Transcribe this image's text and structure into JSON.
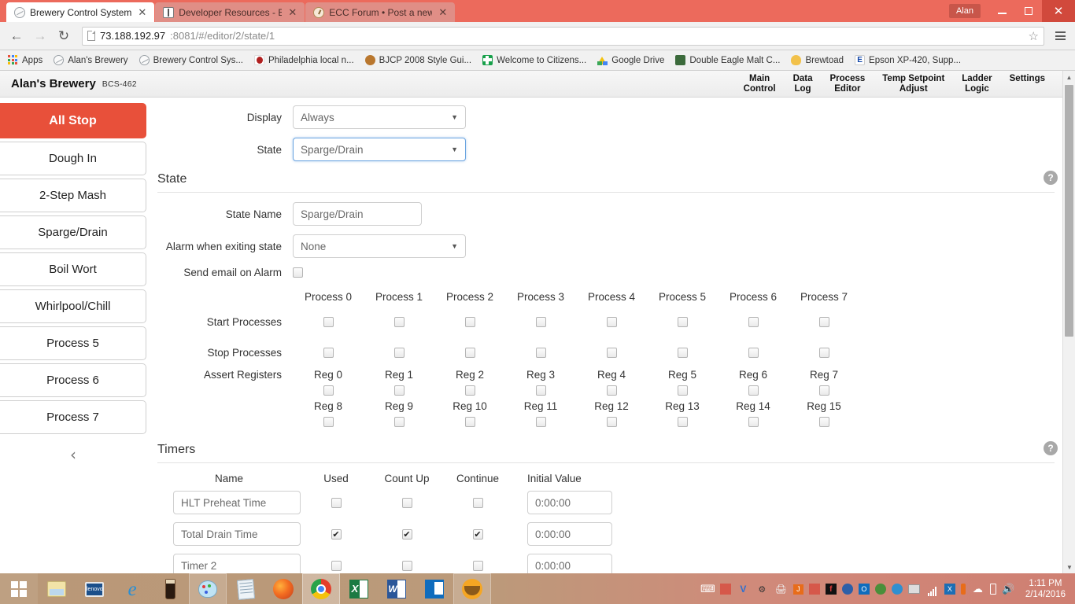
{
  "browser": {
    "tabs": [
      {
        "label": "Brewery Control System",
        "icon": "bcs-dial-icon",
        "active": true
      },
      {
        "label": "Developer Resources - BC",
        "icon": "book-icon",
        "active": false
      },
      {
        "label": "ECC Forum • Post a new to",
        "icon": "clock-icon",
        "active": false
      }
    ],
    "profile": "Alan",
    "window_controls": {
      "minimize": "–",
      "maximize": "□",
      "close": "✕"
    },
    "nav": {
      "back": "←",
      "forward": "→",
      "reload": "↻"
    },
    "url": {
      "host": "73.188.192.97",
      "rest": ":8081/#/editor/2/state/1",
      "full": "73.188.192.97:8081/#/editor/2/state/1"
    },
    "star_icon": "☆",
    "bookmarks": [
      {
        "label": "Apps",
        "icon": "apps-grid-icon"
      },
      {
        "label": "Alan's Brewery",
        "icon": "bcs-dial-icon"
      },
      {
        "label": "Brewery Control Sys...",
        "icon": "bcs-dial-icon"
      },
      {
        "label": "Philadelphia local n...",
        "icon": "red-dot-icon"
      },
      {
        "label": "BJCP 2008 Style Gui...",
        "icon": "bjcp-icon"
      },
      {
        "label": "Welcome to Citizens...",
        "icon": "citizens-icon"
      },
      {
        "label": "Google Drive",
        "icon": "google-drive-icon"
      },
      {
        "label": "Double Eagle Malt C...",
        "icon": "eagle-icon"
      },
      {
        "label": "Brewtoad",
        "icon": "brewtoad-icon"
      },
      {
        "label": "Epson XP-420, Supp...",
        "icon": "epson-e-icon"
      }
    ]
  },
  "app": {
    "brand": "Alan's Brewery",
    "model": "BCS-462",
    "topnav": [
      "Main\nControl",
      "Data\nLog",
      "Process\nEditor",
      "Temp Setpoint\nAdjust",
      "Ladder\nLogic",
      "Settings"
    ],
    "sidebar": {
      "all_stop": "All Stop",
      "items": [
        "Dough In",
        "2-Step Mash",
        "Sparge/Drain",
        "Boil Wort",
        "Whirlpool/Chill",
        "Process 5",
        "Process 6",
        "Process 7"
      ],
      "collapse_icon": "‹"
    },
    "top_form": {
      "display_label": "Display",
      "display_value": "Always",
      "state_label": "State",
      "state_value": "Sparge/Drain"
    },
    "state_section": {
      "title": "State",
      "help": "?",
      "state_name_label": "State Name",
      "state_name_value": "Sparge/Drain",
      "alarm_label": "Alarm when exiting state",
      "alarm_value": "None",
      "email_label": "Send email on Alarm",
      "email_checked": false,
      "process_columns": [
        "Process 0",
        "Process 1",
        "Process 2",
        "Process 3",
        "Process 4",
        "Process 5",
        "Process 6",
        "Process 7"
      ],
      "start_label": "Start Processes",
      "start_checked": [
        false,
        false,
        false,
        false,
        false,
        false,
        false,
        false
      ],
      "stop_label": "Stop Processes",
      "stop_checked": [
        false,
        false,
        false,
        false,
        false,
        false,
        false,
        false
      ],
      "assert_label": "Assert Registers",
      "regs_row1": [
        "Reg 0",
        "Reg 1",
        "Reg 2",
        "Reg 3",
        "Reg 4",
        "Reg 5",
        "Reg 6",
        "Reg 7"
      ],
      "regs_row1_checked": [
        false,
        false,
        false,
        false,
        false,
        false,
        false,
        false
      ],
      "regs_row2": [
        "Reg 8",
        "Reg 9",
        "Reg 10",
        "Reg 11",
        "Reg 12",
        "Reg 13",
        "Reg 14",
        "Reg 15"
      ],
      "regs_row2_checked": [
        false,
        false,
        false,
        false,
        false,
        false,
        false,
        false
      ]
    },
    "timers_section": {
      "title": "Timers",
      "help": "?",
      "headers": [
        "Name",
        "Used",
        "Count Up",
        "Continue",
        "Initial Value"
      ],
      "rows": [
        {
          "name": "HLT Preheat Time",
          "used": false,
          "count_up": false,
          "continue": false,
          "initial": "0:00:00"
        },
        {
          "name": "Total Drain Time",
          "used": true,
          "count_up": true,
          "continue": true,
          "initial": "0:00:00"
        },
        {
          "name": "Timer 2",
          "used": false,
          "count_up": false,
          "continue": false,
          "initial": "0:00:00"
        }
      ]
    },
    "colors": {
      "accent": "#e8503a",
      "header_bg": "#f1f1f1",
      "tab_bar": "#ec6a5c"
    }
  },
  "taskbar": {
    "items": [
      "start-button",
      "file-explorer",
      "lenovo",
      "internet-explorer",
      "beer-glass",
      "paint",
      "notepad",
      "firefox",
      "chrome",
      "excel",
      "word",
      "outlook",
      "thunderbird"
    ],
    "clock_time": "1:11 PM",
    "clock_date": "2/14/2016"
  }
}
